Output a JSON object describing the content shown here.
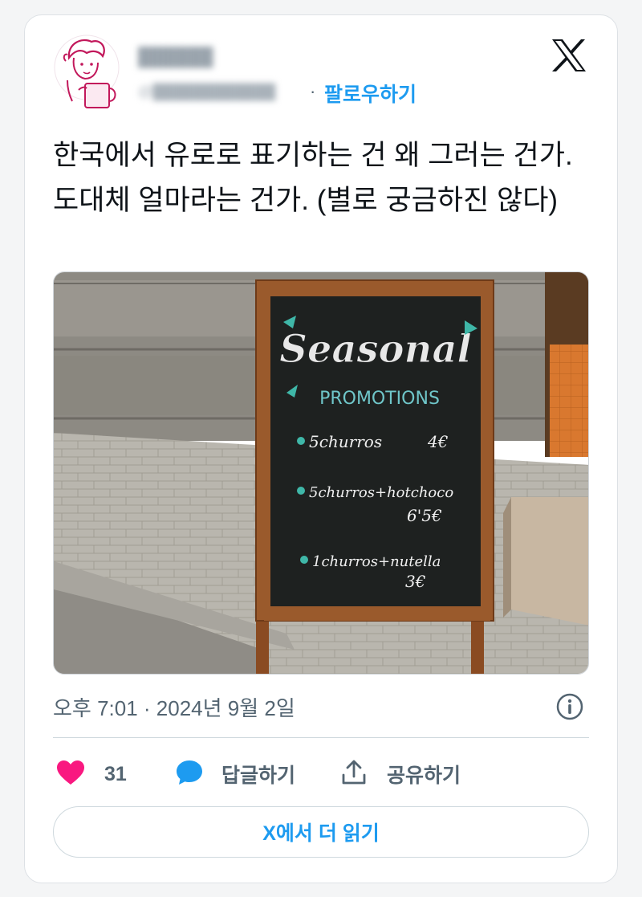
{
  "user": {
    "name": "██████",
    "handle": "@████████████"
  },
  "follow": {
    "separator": "·",
    "label": "팔로우하기"
  },
  "tweet": {
    "text": "한국에서 유로로 표기하는 건 왜 그러는 건가. 도대체 얼마라는 건가. (별로 궁금하진 않다)",
    "time": "오후 7:01",
    "meta_separator": " · ",
    "date": "2024년 9월 2일"
  },
  "sign": {
    "title": "Seasonal",
    "subtitle": "PROMOTIONS",
    "item1": "5churros",
    "price1": "4€",
    "item2": "5churros+hotchoco",
    "price2": "6'5€",
    "item3": "1churros+nutella",
    "price3": "3€"
  },
  "actions": {
    "likes": "31",
    "reply_label": "답글하기",
    "share_label": "공유하기"
  },
  "read_more": "X에서 더 읽기",
  "icons": {
    "brand": "x-logo-icon",
    "like": "heart-icon",
    "reply": "speech-bubble-icon",
    "share": "share-upload-icon",
    "info": "info-icon"
  },
  "colors": {
    "accent": "#1d9bf0",
    "like": "#f91880",
    "text": "#0f1419",
    "muted": "#536471"
  }
}
